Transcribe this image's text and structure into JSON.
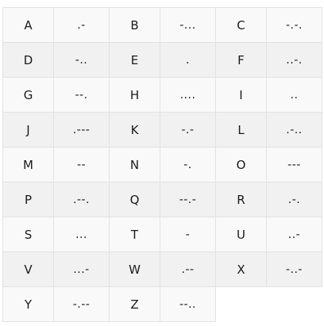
{
  "morse_table": {
    "rows": [
      [
        {
          "letter": "A",
          "code": ".-"
        },
        {
          "letter": "B",
          "code": "-..."
        },
        {
          "letter": "C",
          "code": "-.-."
        }
      ],
      [
        {
          "letter": "D",
          "code": "-.."
        },
        {
          "letter": "E",
          "code": "."
        },
        {
          "letter": "F",
          "code": "..-."
        }
      ],
      [
        {
          "letter": "G",
          "code": "--."
        },
        {
          "letter": "H",
          "code": "...."
        },
        {
          "letter": "I",
          "code": ".."
        }
      ],
      [
        {
          "letter": "J",
          "code": ".---"
        },
        {
          "letter": "K",
          "code": "-.-"
        },
        {
          "letter": "L",
          "code": ".-.."
        }
      ],
      [
        {
          "letter": "M",
          "code": "--"
        },
        {
          "letter": "N",
          "code": "-."
        },
        {
          "letter": "O",
          "code": "---"
        }
      ],
      [
        {
          "letter": "P",
          "code": ".--."
        },
        {
          "letter": "Q",
          "code": "--.-"
        },
        {
          "letter": "R",
          "code": ".-."
        }
      ],
      [
        {
          "letter": "S",
          "code": "..."
        },
        {
          "letter": "T",
          "code": "-"
        },
        {
          "letter": "U",
          "code": "..-"
        }
      ],
      [
        {
          "letter": "V",
          "code": "...-"
        },
        {
          "letter": "W",
          "code": ".--"
        },
        {
          "letter": "X",
          "code": "-..-"
        }
      ],
      [
        {
          "letter": "Y",
          "code": "-.--"
        },
        {
          "letter": "Z",
          "code": "--.."
        }
      ]
    ]
  }
}
